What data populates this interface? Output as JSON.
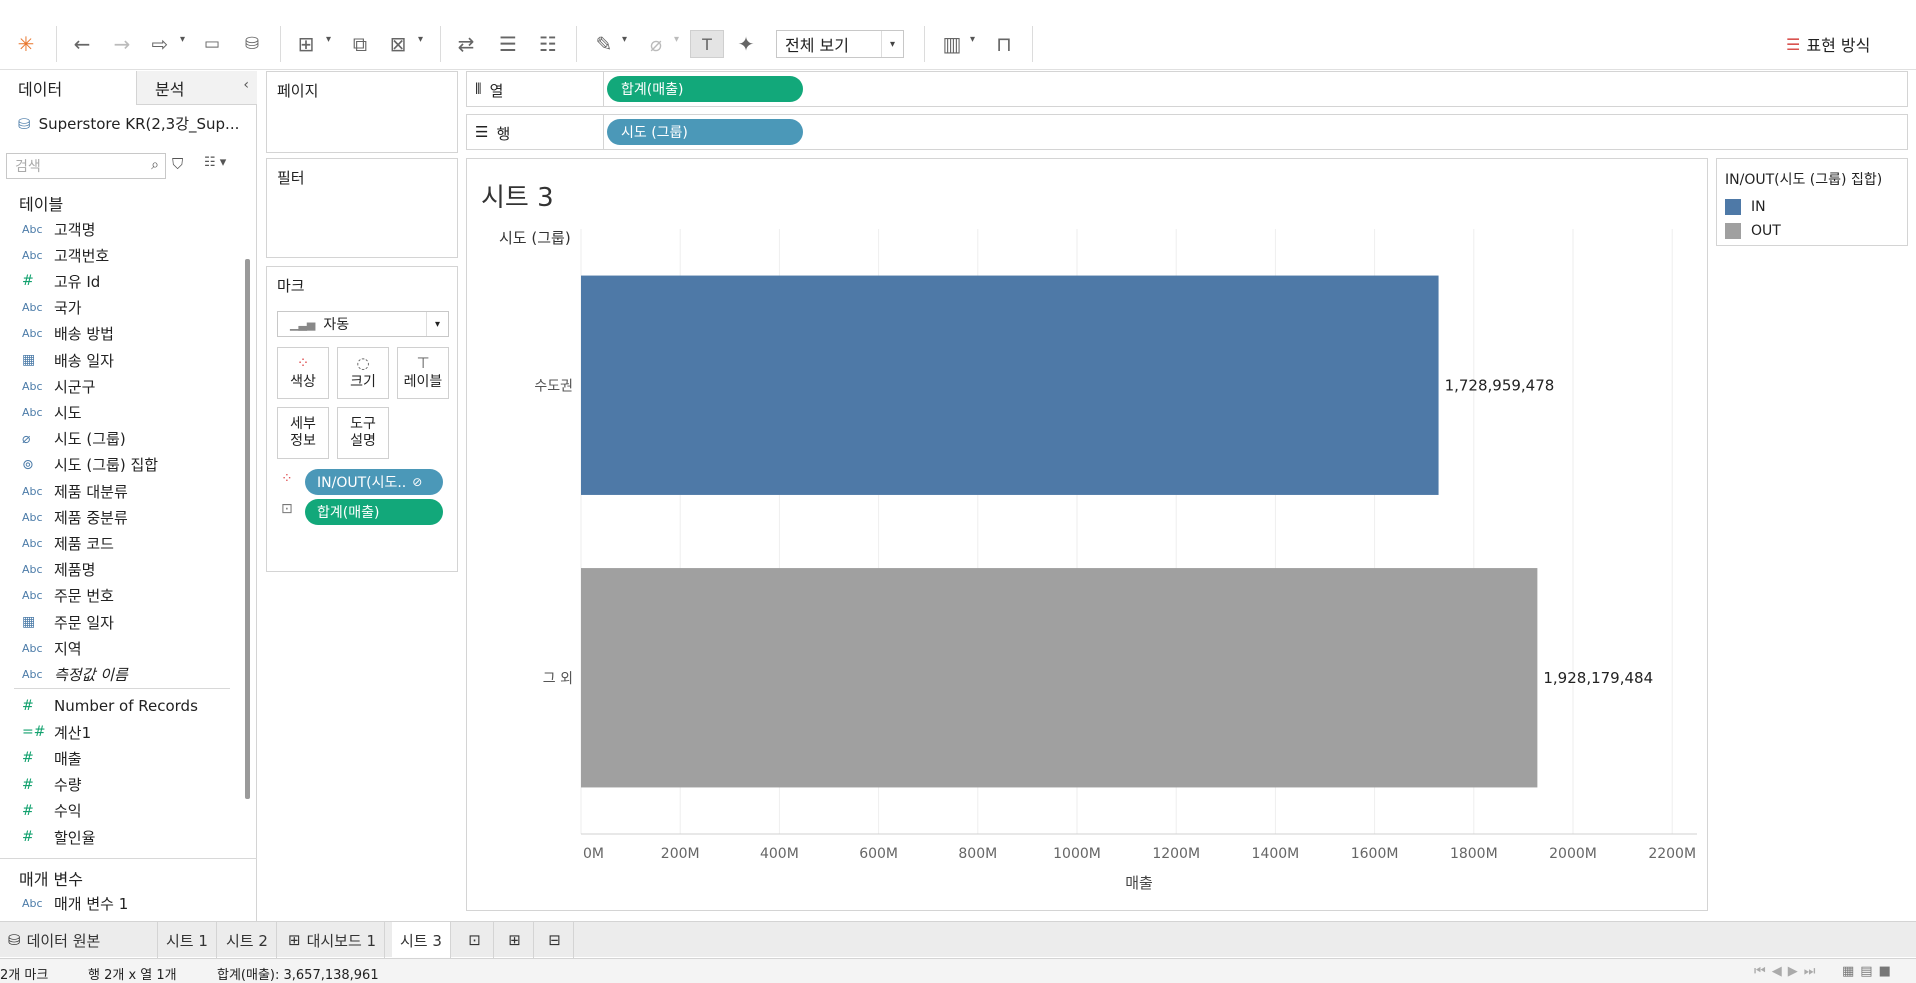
{
  "toolbar": {
    "view_mode": "전체 보기",
    "show_me": "표현 방식",
    "icons": [
      "tableau-logo-icon",
      "undo-icon",
      "redo-icon",
      "forward-icon",
      "save-icon",
      "new-datasource-icon",
      "new-worksheet-icon",
      "duplicate-icon",
      "clear-icon",
      "swap-icon",
      "sort-asc-icon",
      "sort-desc-icon",
      "highlight-icon",
      "group-icon",
      "label-icon",
      "pin-icon",
      "presentation-icon"
    ]
  },
  "datapane": {
    "tab_data": "데이터",
    "tab_analysis": "분석",
    "datasource": "Superstore KR(2,3강_Sup...",
    "search_placeholder": "검색",
    "tables_header": "테이블",
    "fields": [
      {
        "type": "Abc",
        "name": "고객명"
      },
      {
        "type": "Abc",
        "name": "고객번호"
      },
      {
        "type": "#",
        "name": "고유 Id"
      },
      {
        "type": "Abc",
        "name": "국가"
      },
      {
        "type": "Abc",
        "name": "배송 방법"
      },
      {
        "type": "date",
        "name": "배송 일자"
      },
      {
        "type": "Abc",
        "name": "시군구"
      },
      {
        "type": "Abc",
        "name": "시도"
      },
      {
        "type": "clip",
        "name": "시도 (그룹)"
      },
      {
        "type": "set",
        "name": "시도 (그룹) 집합"
      },
      {
        "type": "Abc",
        "name": "제품 대분류"
      },
      {
        "type": "Abc",
        "name": "제품 중분류"
      },
      {
        "type": "Abc",
        "name": "제품 코드"
      },
      {
        "type": "Abc",
        "name": "제품명"
      },
      {
        "type": "Abc",
        "name": "주문 번호"
      },
      {
        "type": "date",
        "name": "주문 일자"
      },
      {
        "type": "Abc",
        "name": "지역"
      },
      {
        "type": "Abc",
        "name": "측정값 이름"
      }
    ],
    "measures": [
      {
        "type": "#",
        "name": "Number of Records"
      },
      {
        "type": "=#",
        "name": "계산1"
      },
      {
        "type": "#",
        "name": "매출"
      },
      {
        "type": "#",
        "name": "수량"
      },
      {
        "type": "#",
        "name": "수익"
      },
      {
        "type": "#",
        "name": "할인율"
      }
    ],
    "params_header": "매개 변수",
    "params": [
      {
        "type": "Abc",
        "name": "매개 변수 1"
      }
    ]
  },
  "cards": {
    "pages": "페이지",
    "filters": "필터",
    "marks": "마크",
    "marks_type": "자동",
    "buttons": [
      "색상",
      "크기",
      "레이블"
    ],
    "buttons2": [
      [
        "세부",
        "정보"
      ],
      [
        "도구",
        "설명"
      ]
    ],
    "pills": [
      "IN/OUT(시도..",
      "합계(매출)"
    ]
  },
  "shelves": {
    "columns_label": "열",
    "columns_pill": "합계(매출)",
    "rows_label": "행",
    "rows_pill": "시도 (그룹)"
  },
  "colors": {
    "green_pill": "#12a87a",
    "blue_pill": "#4b98b8",
    "bar_in": "#4e79a7",
    "bar_out": "#a0a0a0"
  },
  "sheet": {
    "title": "시트 3",
    "row_header": "시도 (그룹)"
  },
  "chart_data": {
    "type": "bar",
    "orientation": "horizontal",
    "categories": [
      "수도권",
      "그 외"
    ],
    "values": [
      1728959478,
      1928179484
    ],
    "labels": [
      "1,728,959,478",
      "1,928,179,484"
    ],
    "colors": [
      "#4e79a7",
      "#a0a0a0"
    ],
    "xlabel": "매출",
    "ylabel": "시도 (그룹)",
    "xlim": [
      0,
      2250000000
    ],
    "xticks": [
      0,
      200000000,
      400000000,
      600000000,
      800000000,
      1000000000,
      1200000000,
      1400000000,
      1600000000,
      1800000000,
      2000000000,
      2200000000
    ],
    "xtick_labels": [
      "0M",
      "200M",
      "400M",
      "600M",
      "800M",
      "1000M",
      "1200M",
      "1400M",
      "1600M",
      "1800M",
      "2000M",
      "2200M"
    ],
    "grid": true
  },
  "legend": {
    "title": "IN/OUT(시도 (그룹) 집합)",
    "items": [
      {
        "label": "IN",
        "color": "#4e79a7"
      },
      {
        "label": "OUT",
        "color": "#a0a0a0"
      }
    ]
  },
  "tabs": {
    "datasource": "데이터 원본",
    "sheets": [
      "시트 1",
      "시트 2",
      "대시보드 1",
      "시트 3"
    ]
  },
  "status": {
    "marks": "2개 마크",
    "rows_cols": "행 2개 x 열 1개",
    "sum": "합계(매출): 3,657,138,961"
  }
}
